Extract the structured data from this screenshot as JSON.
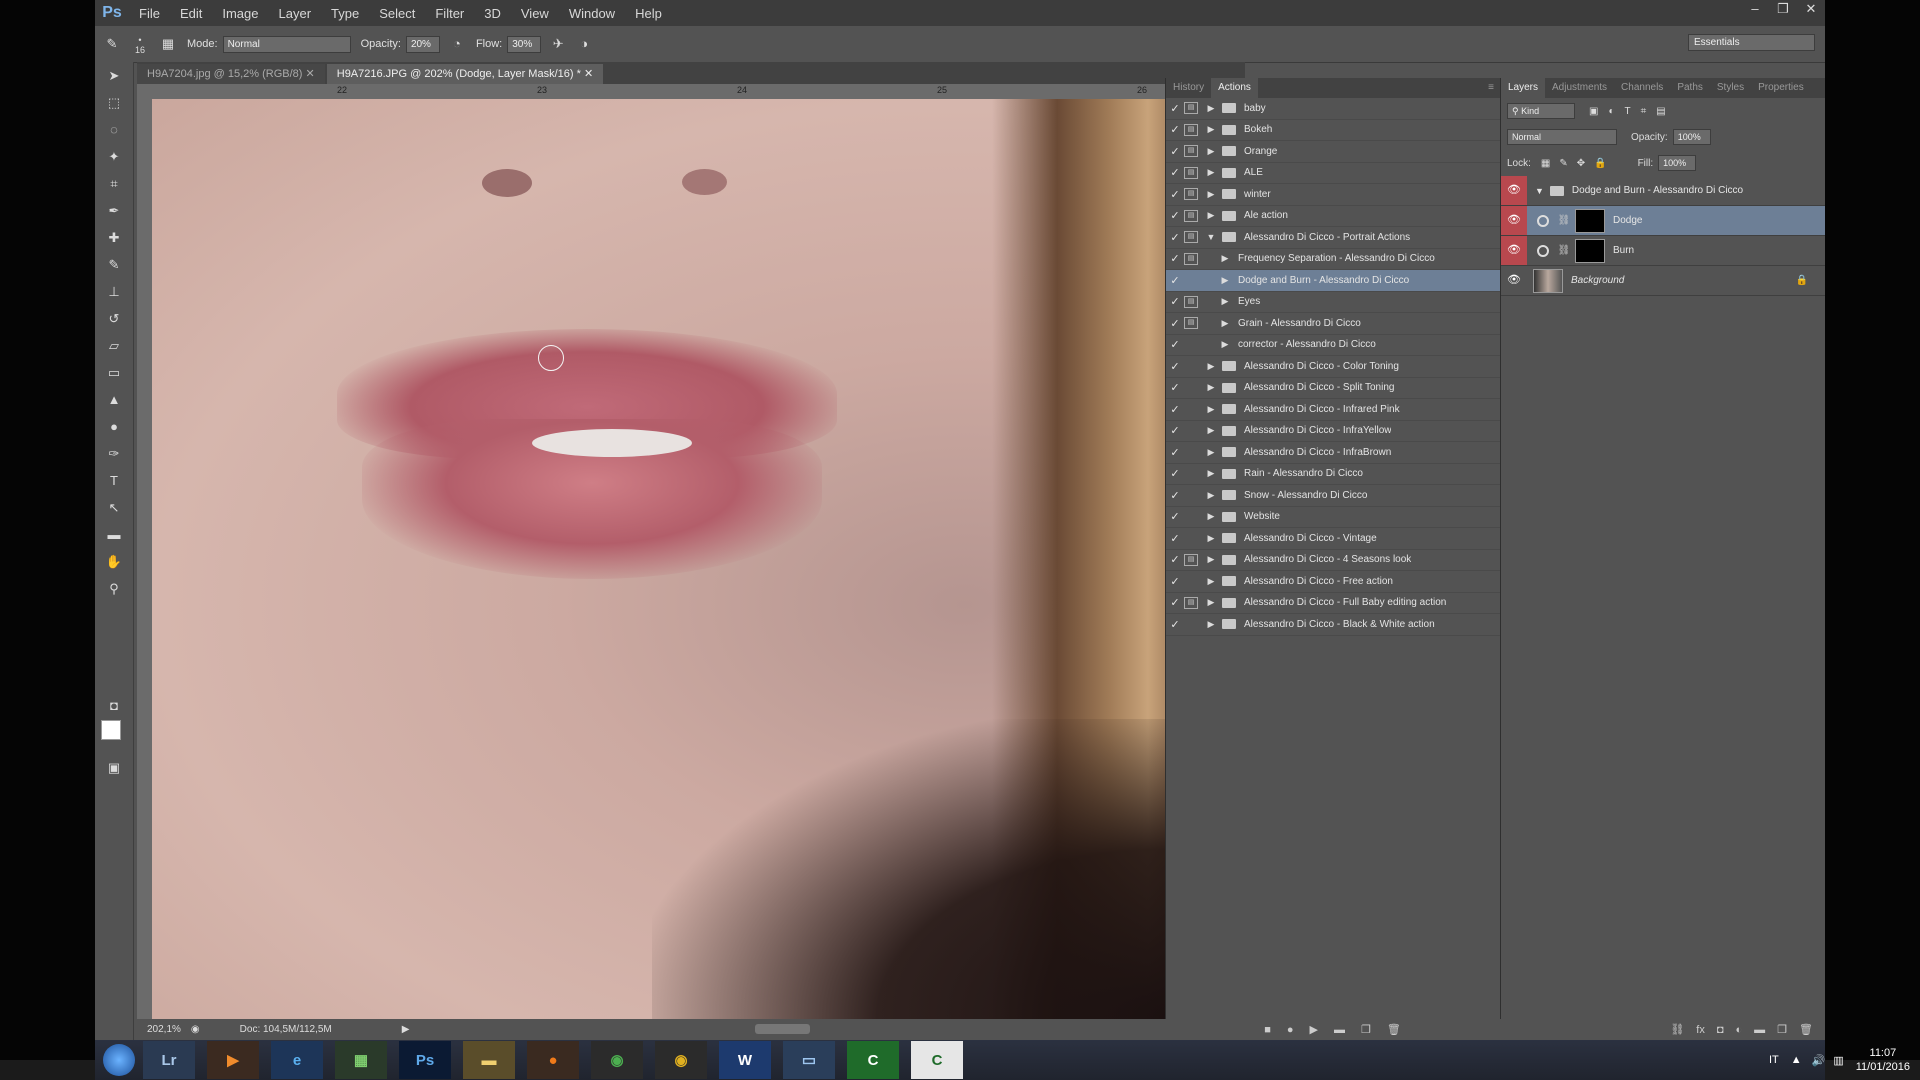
{
  "app": {
    "logo": "Ps",
    "menu": [
      "File",
      "Edit",
      "Image",
      "Layer",
      "Type",
      "Select",
      "Filter",
      "3D",
      "View",
      "Window",
      "Help"
    ],
    "window_controls": [
      "–",
      "❐",
      "✕"
    ]
  },
  "options_bar": {
    "brush_size": "16",
    "mode_label": "Mode:",
    "mode_value": "Normal",
    "opacity_label": "Opacity:",
    "opacity_value": "20%",
    "flow_label": "Flow:",
    "flow_value": "30%",
    "workspace": "Essentials"
  },
  "document": {
    "tabs": [
      {
        "label": "H9A7204.jpg @ 15,2% (RGB/8)",
        "active": false
      },
      {
        "label": "H9A7216.JPG @ 202% (Dodge, Layer Mask/16) *",
        "active": true
      }
    ],
    "ruler_marks": [
      "22",
      "23",
      "24",
      "25",
      "26"
    ],
    "zoom": "202,1%",
    "doc_size": "Doc: 104,5M/112,5M"
  },
  "actions_panel": {
    "tabs": [
      "History",
      "Actions"
    ],
    "active_tab": "Actions",
    "rows": [
      {
        "label": "baby",
        "level": 0,
        "expanded": false,
        "dialog": true,
        "selected": false
      },
      {
        "label": "Bokeh",
        "level": 0,
        "expanded": false,
        "dialog": true,
        "selected": false
      },
      {
        "label": "Orange",
        "level": 0,
        "expanded": false,
        "dialog": true,
        "selected": false
      },
      {
        "label": "ALE",
        "level": 0,
        "expanded": false,
        "dialog": true,
        "selected": false
      },
      {
        "label": "winter",
        "level": 0,
        "expanded": false,
        "dialog": true,
        "selected": false
      },
      {
        "label": "Ale action",
        "level": 0,
        "expanded": false,
        "dialog": true,
        "selected": false
      },
      {
        "label": "Alessandro Di Cicco - Portrait Actions",
        "level": 0,
        "expanded": true,
        "dialog": true,
        "selected": false
      },
      {
        "label": "Frequency Separation - Alessandro Di Cicco",
        "level": 1,
        "expanded": false,
        "dialog": true,
        "selected": false
      },
      {
        "label": "Dodge and Burn - Alessandro Di Cicco",
        "level": 1,
        "expanded": false,
        "dialog": false,
        "selected": true
      },
      {
        "label": "Eyes",
        "level": 1,
        "expanded": false,
        "dialog": true,
        "selected": false
      },
      {
        "label": "Grain - Alessandro Di Cicco",
        "level": 1,
        "expanded": false,
        "dialog": true,
        "selected": false
      },
      {
        "label": "corrector - Alessandro Di Cicco",
        "level": 1,
        "expanded": false,
        "dialog": false,
        "selected": false
      },
      {
        "label": "Alessandro Di Cicco - Color Toning",
        "level": 0,
        "expanded": false,
        "dialog": false,
        "selected": false
      },
      {
        "label": "Alessandro Di Cicco - Split Toning",
        "level": 0,
        "expanded": false,
        "dialog": false,
        "selected": false
      },
      {
        "label": "Alessandro Di Cicco - Infrared Pink",
        "level": 0,
        "expanded": false,
        "dialog": false,
        "selected": false
      },
      {
        "label": "Alessandro Di Cicco - InfraYellow",
        "level": 0,
        "expanded": false,
        "dialog": false,
        "selected": false
      },
      {
        "label": "Alessandro Di Cicco - InfraBrown",
        "level": 0,
        "expanded": false,
        "dialog": false,
        "selected": false
      },
      {
        "label": "Rain - Alessandro Di Cicco",
        "level": 0,
        "expanded": false,
        "dialog": false,
        "selected": false
      },
      {
        "label": "Snow - Alessandro Di Cicco",
        "level": 0,
        "expanded": false,
        "dialog": false,
        "selected": false
      },
      {
        "label": "Website",
        "level": 0,
        "expanded": false,
        "dialog": false,
        "selected": false
      },
      {
        "label": "Alessandro Di Cicco - Vintage",
        "level": 0,
        "expanded": false,
        "dialog": false,
        "selected": false
      },
      {
        "label": "Alessandro Di Cicco - 4 Seasons look",
        "level": 0,
        "expanded": false,
        "dialog": true,
        "selected": false
      },
      {
        "label": "Alessandro Di Cicco - Free action",
        "level": 0,
        "expanded": false,
        "dialog": false,
        "selected": false
      },
      {
        "label": "Alessandro Di Cicco - Full Baby editing action",
        "level": 0,
        "expanded": false,
        "dialog": true,
        "selected": false
      },
      {
        "label": "Alessandro Di Cicco - Black & White action",
        "level": 0,
        "expanded": false,
        "dialog": false,
        "selected": false
      }
    ]
  },
  "layers_panel": {
    "tabs": [
      "Layers",
      "Adjustments",
      "Channels",
      "Paths",
      "Styles",
      "Properties"
    ],
    "active_tab": "Layers",
    "filter_label": "Kind",
    "blend_mode": "Normal",
    "opacity_label": "Opacity:",
    "opacity_value": "100%",
    "lock_label": "Lock:",
    "fill_label": "Fill:",
    "fill_value": "100%",
    "group_name": "Dodge and Burn - Alessandro Di Cicco",
    "layers": [
      {
        "name": "Dodge",
        "selected": true
      },
      {
        "name": "Burn",
        "selected": false
      }
    ],
    "background_name": "Background"
  },
  "taskbar": {
    "apps": [
      {
        "label": "Lr",
        "color": "#2a3a52",
        "text": "#a9c7e8"
      },
      {
        "label": "▶",
        "color": "#3b2a20",
        "text": "#f08b2c"
      },
      {
        "label": "e",
        "color": "#1d3558",
        "text": "#5ab0f0"
      },
      {
        "label": "▦",
        "color": "#2a3a2a",
        "text": "#7fcf6f"
      },
      {
        "label": "Ps",
        "color": "#0b1a33",
        "text": "#5fa9ea"
      },
      {
        "label": "▬",
        "color": "#5a4d2a",
        "text": "#f0d070"
      },
      {
        "label": "●",
        "color": "#3a2a20",
        "text": "#ef7a1a"
      },
      {
        "label": "◉",
        "color": "#2b2b2b",
        "text": "#4caf50"
      },
      {
        "label": "◉",
        "color": "#2b2b2b",
        "text": "#e0b020"
      },
      {
        "label": "W",
        "color": "#1d3a6e",
        "text": "#ffffff"
      },
      {
        "label": "▭",
        "color": "#2a3e5a",
        "text": "#9ec6f0"
      },
      {
        "label": "C",
        "color": "#1f6b2a",
        "text": "#ffffff"
      },
      {
        "label": "C",
        "color": "#e6e6e6",
        "text": "#1f6b2a"
      }
    ],
    "lang": "IT",
    "time": "11:07",
    "date": "11/01/2016"
  }
}
